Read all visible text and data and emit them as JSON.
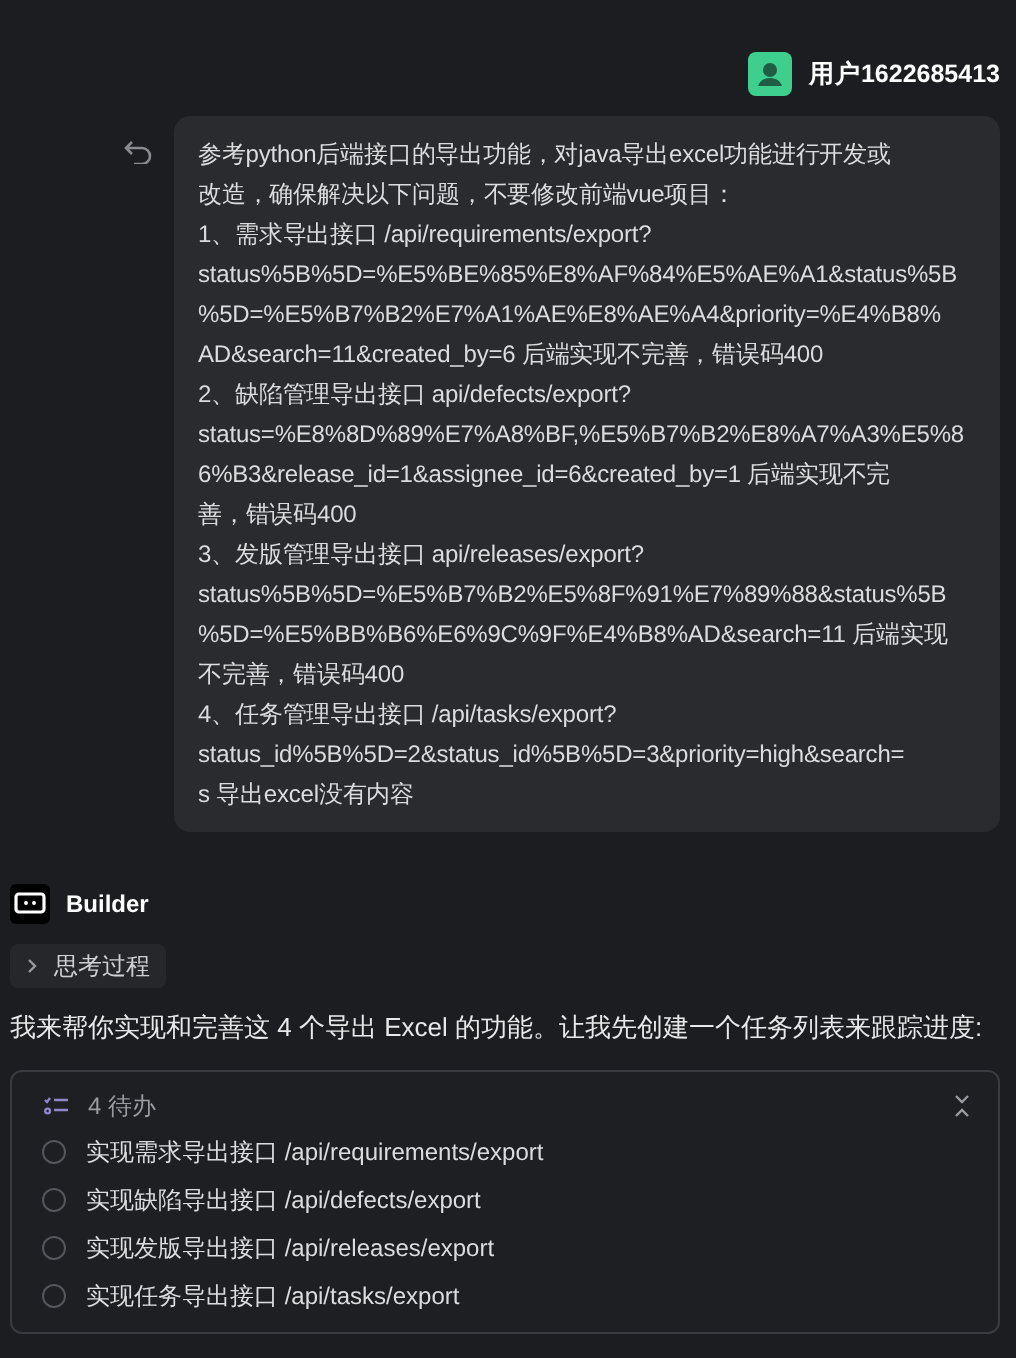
{
  "user": {
    "name": "用户1622685413"
  },
  "message": {
    "lines": [
      "参考python后端接口的导出功能，对java导出excel功能进行开发或",
      "改造，确保解决以下问题，不要修改前端vue项目：",
      "1、需求导出接口 /api/requirements/export?",
      "status%5B%5D=%E5%BE%85%E8%AF%84%E5%AE%A1&status%5B",
      "%5D=%E5%B7%B2%E7%A1%AE%E8%AE%A4&priority=%E4%B8%",
      "AD&search=11&created_by=6 后端实现不完善，错误码400",
      "2、缺陷管理导出接口 api/defects/export?",
      "status=%E8%8D%89%E7%A8%BF,%E5%B7%B2%E8%A7%A3%E5%8",
      "6%B3&release_id=1&assignee_id=6&created_by=1 后端实现不完",
      "善，错误码400",
      "3、发版管理导出接口 api/releases/export?",
      "status%5B%5D=%E5%B7%B2%E5%8F%91%E7%89%88&status%5B",
      "%5D=%E5%BB%B6%E6%9C%9F%E4%B8%AD&search=11 后端实现",
      "不完善，错误码400",
      "4、任务管理导出接口 /api/tasks/export?",
      "status_id%5B%5D=2&status_id%5B%5D=3&priority=high&search=",
      "s 导出excel没有内容"
    ]
  },
  "assistant": {
    "name": "Builder"
  },
  "thinking": {
    "label": "思考过程",
    "expanded": false
  },
  "reply": "我来帮你实现和完善这 4 个导出 Excel 的功能。让我先创建一个任务列表来跟踪进度:",
  "todo": {
    "title": "4 待办",
    "items": [
      {
        "label": "实现需求导出接口 /api/requirements/export",
        "checked": false
      },
      {
        "label": "实现缺陷导出接口 /api/defects/export",
        "checked": false
      },
      {
        "label": "实现发版导出接口 /api/releases/export",
        "checked": false
      },
      {
        "label": "实现任务导出接口 /api/tasks/export",
        "checked": false
      }
    ]
  }
}
